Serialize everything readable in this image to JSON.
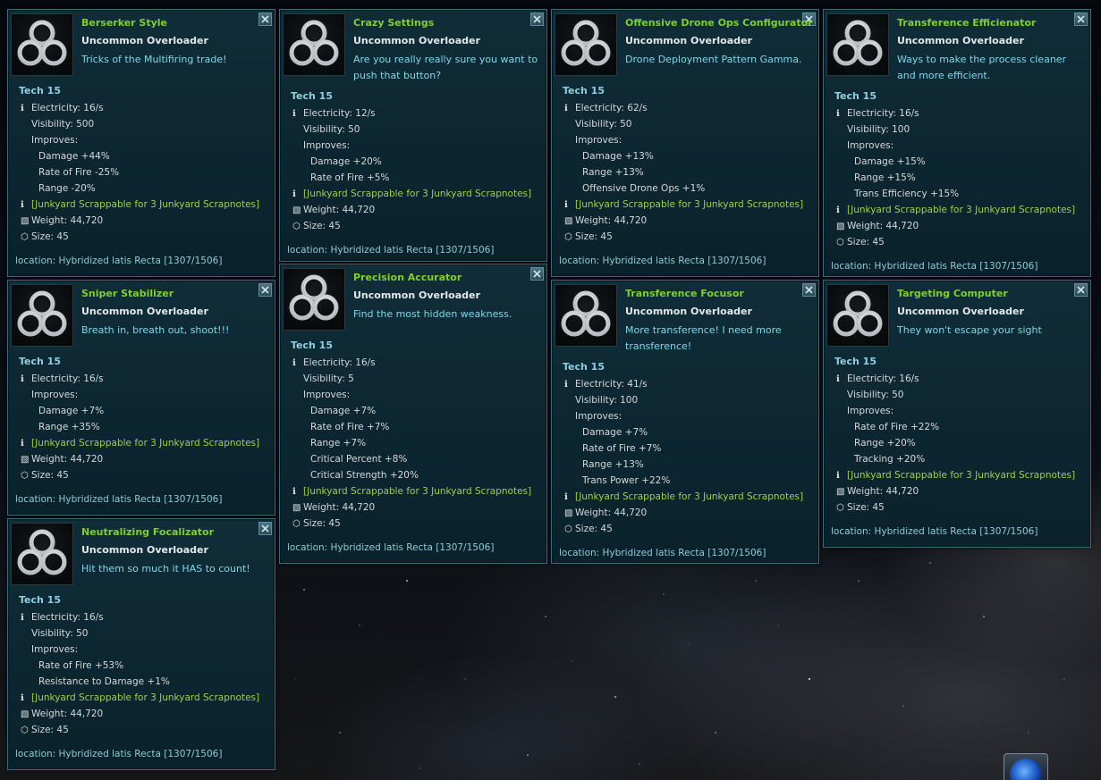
{
  "cards": [
    {
      "title": "Berserker Style",
      "rarity": "Uncommon Overloader",
      "desc": "Tricks of the Multifiring trade!",
      "tech": "Tech 15",
      "electricity": "Electricity: 16/s",
      "visibility": "Visibility: 500",
      "improves": "Improves:",
      "stats": [
        "Damage +44%",
        "Rate of Fire -25%",
        "Range -20%"
      ],
      "junk": "[Junkyard Scrappable for 3 Junkyard Scrapnotes]",
      "weight": "Weight: 44,720",
      "size": "Size: 45",
      "location": "location: Hybridized latis Recta [1307/1506]"
    },
    {
      "title": "Crazy Settings",
      "rarity": "Uncommon Overloader",
      "desc": "Are you really really sure you want to push that button?",
      "tech": "Tech 15",
      "electricity": "Electricity: 12/s",
      "visibility": "Visibility: 50",
      "improves": "Improves:",
      "stats": [
        "Damage +20%",
        "Rate of Fire +5%"
      ],
      "junk": "[Junkyard Scrappable for 3 Junkyard Scrapnotes]",
      "weight": "Weight: 44,720",
      "size": "Size: 45",
      "location": "location: Hybridized latis Recta [1307/1506]"
    },
    {
      "title": "Offensive Drone Ops Configurator",
      "rarity": "Uncommon Overloader",
      "desc": "Drone Deployment Pattern Gamma.",
      "tech": "Tech 15",
      "electricity": "Electricity: 62/s",
      "visibility": "Visibility: 50",
      "improves": "Improves:",
      "stats": [
        "Damage +13%",
        "Range +13%",
        "Offensive Drone Ops +1%"
      ],
      "junk": "[Junkyard Scrappable for 3 Junkyard Scrapnotes]",
      "weight": "Weight: 44,720",
      "size": "Size: 45",
      "location": "location: Hybridized latis Recta [1307/1506]"
    },
    {
      "title": "Transference Efficienator",
      "rarity": "Uncommon Overloader",
      "desc": "Ways to make the process cleaner and more efficient.",
      "tech": "Tech 15",
      "electricity": "Electricity: 16/s",
      "visibility": "Visibility: 100",
      "improves": "Improves:",
      "stats": [
        "Damage +15%",
        "Range +15%",
        "Trans Efficiency +15%"
      ],
      "junk": "[Junkyard Scrappable for 3 Junkyard Scrapnotes]",
      "weight": "Weight: 44,720",
      "size": "Size: 45",
      "location": "location: Hybridized latis Recta [1307/1506]"
    },
    {
      "title": "Sniper Stabilizer",
      "rarity": "Uncommon Overloader",
      "desc": "Breath in, breath out, shoot!!!",
      "tech": "Tech 15",
      "electricity": "Electricity: 16/s",
      "visibility": "",
      "improves": "Improves:",
      "stats": [
        "Damage +7%",
        "Range +35%"
      ],
      "junk": "[Junkyard Scrappable for 3 Junkyard Scrapnotes]",
      "weight": "Weight: 44,720",
      "size": "Size: 45",
      "location": "location: Hybridized latis Recta [1307/1506]"
    },
    {
      "title": "Precision Accurator",
      "rarity": "Uncommon Overloader",
      "desc": "Find the most hidden weakness.",
      "tech": "Tech 15",
      "electricity": "Electricity: 16/s",
      "visibility": "Visibility: 5",
      "improves": "Improves:",
      "stats": [
        "Damage +7%",
        "Rate of Fire +7%",
        "Range +7%",
        "Critical Percent +8%",
        "Critical Strength +20%"
      ],
      "junk": "[Junkyard Scrappable for 3 Junkyard Scrapnotes]",
      "weight": "Weight: 44,720",
      "size": "Size: 45",
      "location": "location: Hybridized latis Recta [1307/1506]"
    },
    {
      "title": "Transference Focusor",
      "rarity": "Uncommon Overloader",
      "desc": "More transference! I need more transference!",
      "tech": "Tech 15",
      "electricity": "Electricity: 41/s",
      "visibility": "Visibility: 100",
      "improves": "Improves:",
      "stats": [
        "Damage +7%",
        "Rate of Fire +7%",
        "Range +13%",
        "Trans Power +22%"
      ],
      "junk": "[Junkyard Scrappable for 3 Junkyard Scrapnotes]",
      "weight": "Weight: 44,720",
      "size": "Size: 45",
      "location": "location: Hybridized latis Recta [1307/1506]"
    },
    {
      "title": "Targeting Computer",
      "rarity": "Uncommon Overloader",
      "desc": "They won't escape your sight",
      "tech": "Tech 15",
      "electricity": "Electricity: 16/s",
      "visibility": "Visibility: 50",
      "improves": "Improves:",
      "stats": [
        "Rate of Fire +22%",
        "Range +20%",
        "Tracking +20%"
      ],
      "junk": "[Junkyard Scrappable for 3 Junkyard Scrapnotes]",
      "weight": "Weight: 44,720",
      "size": "Size: 45",
      "location": "location: Hybridized latis Recta [1307/1506]"
    },
    {
      "title": "Neutralizing Focalizator",
      "rarity": "Uncommon Overloader",
      "desc": "Hit them so much it HAS to count!",
      "tech": "Tech 15",
      "electricity": "Electricity: 16/s",
      "visibility": "Visibility: 50",
      "improves": "Improves:",
      "stats": [
        "Rate of Fire +53%",
        "Resistance to Damage +1%"
      ],
      "junk": "[Junkyard Scrappable for 3 Junkyard Scrapnotes]",
      "weight": "Weight: 44,720",
      "size": "Size: 45",
      "location": "location: Hybridized latis Recta [1307/1506]"
    }
  ],
  "colors": {
    "title": "#7fd02b",
    "description": "#7ed8e8",
    "junk": "#9ed04a",
    "panel": "#0f2e3a",
    "border": "#3d6c7c"
  },
  "icons": {
    "item": "triple-ring-icon",
    "close": "close-icon",
    "info": "info-icon",
    "weight": "weight-icon",
    "size": "cube-icon"
  }
}
